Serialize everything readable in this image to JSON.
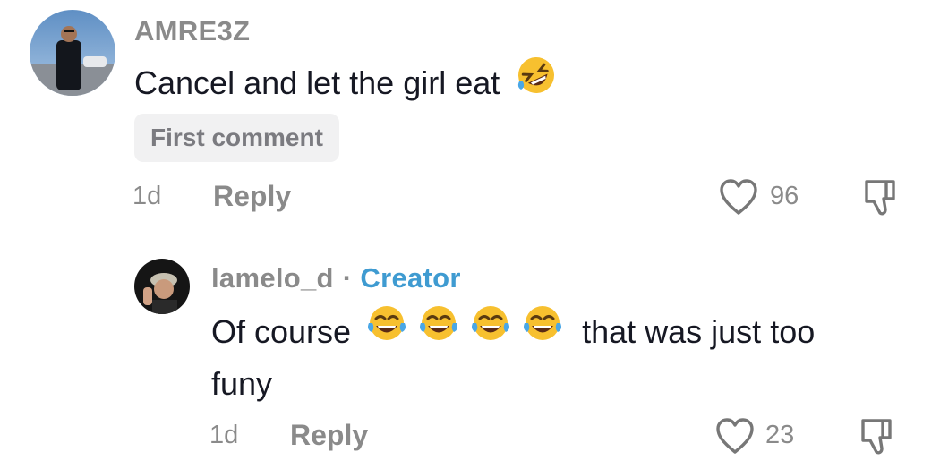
{
  "comment": {
    "username": "AMRE3Z",
    "text": "Cancel and let the girl eat",
    "emoji": "rolling-on-floor-laughing-emoji",
    "badge": "First comment",
    "time": "1d",
    "reply_label": "Reply",
    "likes": "96"
  },
  "reply": {
    "username": "lamelo_d",
    "separator": "·",
    "role": "Creator",
    "text_start": "Of course",
    "emojis": [
      "face-with-tears-of-joy-emoji",
      "face-with-tears-of-joy-emoji",
      "face-with-tears-of-joy-emoji",
      "face-with-tears-of-joy-emoji"
    ],
    "text_end_line1": "that was just too",
    "text_line2": "funy",
    "time": "1d",
    "reply_label": "Reply",
    "likes": "23"
  },
  "colors": {
    "muted": "#8a8a8a",
    "creator": "#3f9bd1",
    "badge_bg": "#f1f1f2",
    "text": "#161823",
    "emoji_yellow": "#f7c02f"
  }
}
